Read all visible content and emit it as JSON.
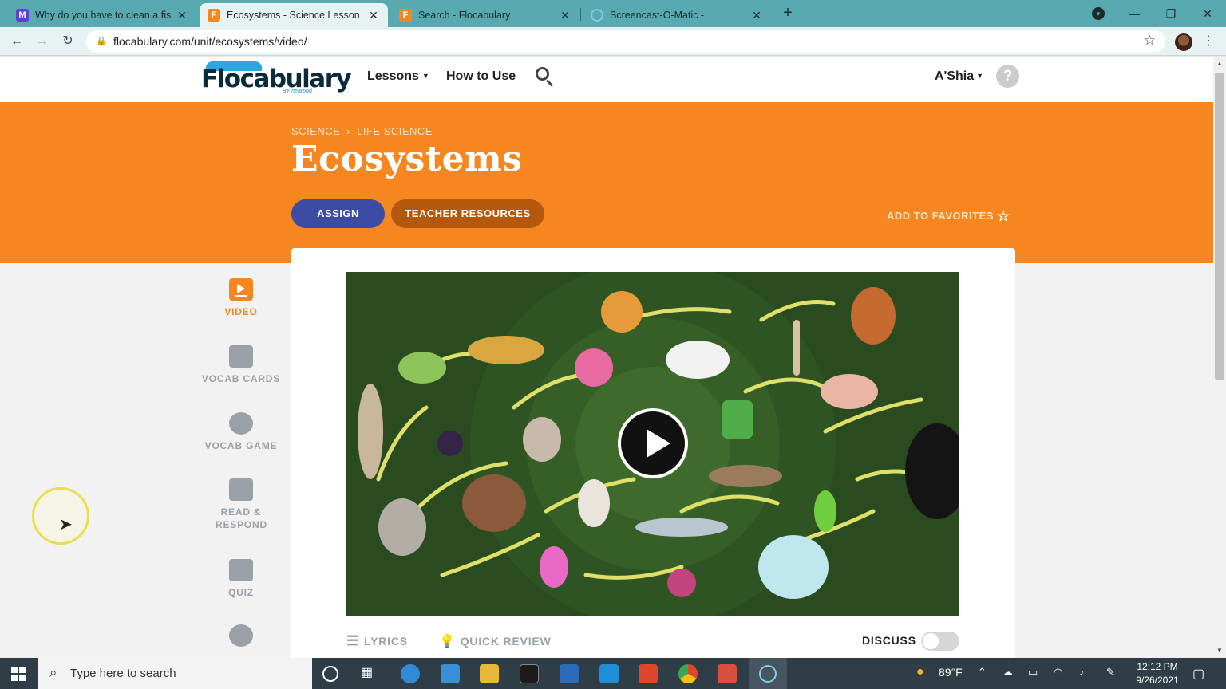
{
  "browser": {
    "tabs": [
      {
        "title": "Why do you have to clean a fish",
        "favicon": "M",
        "favicon_color": "#5a3fd0"
      },
      {
        "title": "Ecosystems - Science Lesson Pla",
        "favicon": "F",
        "favicon_color": "#f6861f"
      },
      {
        "title": "Search - Flocabulary",
        "favicon": "F",
        "favicon_color": "#f6861f"
      },
      {
        "title": "Screencast-O-Matic -",
        "favicon": "",
        "favicon_color": "#8ac8e8"
      }
    ],
    "new_tab_label": "+",
    "url": "flocabulary.com/unit/ecosystems/video/"
  },
  "site": {
    "logo_text": "Flocabulary",
    "logo_sub": "BY nearpod",
    "nav": {
      "lessons": "Lessons",
      "how_to_use": "How to Use"
    },
    "user": "A'Shia",
    "help_symbol": "?"
  },
  "lesson": {
    "breadcrumb": [
      "SCIENCE",
      "LIFE SCIENCE"
    ],
    "title": "Ecosystems",
    "assign_label": "ASSIGN",
    "teacher_resources_label": "TEACHER RESOURCES",
    "favorites_label": "ADD TO FAVORITES"
  },
  "sidenav": [
    {
      "label": "VIDEO",
      "icon": "video-icon",
      "active": true
    },
    {
      "label": "VOCAB CARDS",
      "icon": "cards-icon",
      "active": false
    },
    {
      "label": "VOCAB GAME",
      "icon": "lightning-icon",
      "active": false
    },
    {
      "label": "READ & RESPOND",
      "icon": "book-icon",
      "active": false
    },
    {
      "label": "QUIZ",
      "icon": "checklist-icon",
      "active": false
    }
  ],
  "video_tabs": {
    "lyrics": "LYRICS",
    "quick_review": "QUICK REVIEW",
    "discuss": "DISCUSS"
  },
  "taskbar": {
    "search_placeholder": "Type here to search",
    "weather": "89°F",
    "time": "12:12 PM",
    "date": "9/26/2021"
  }
}
